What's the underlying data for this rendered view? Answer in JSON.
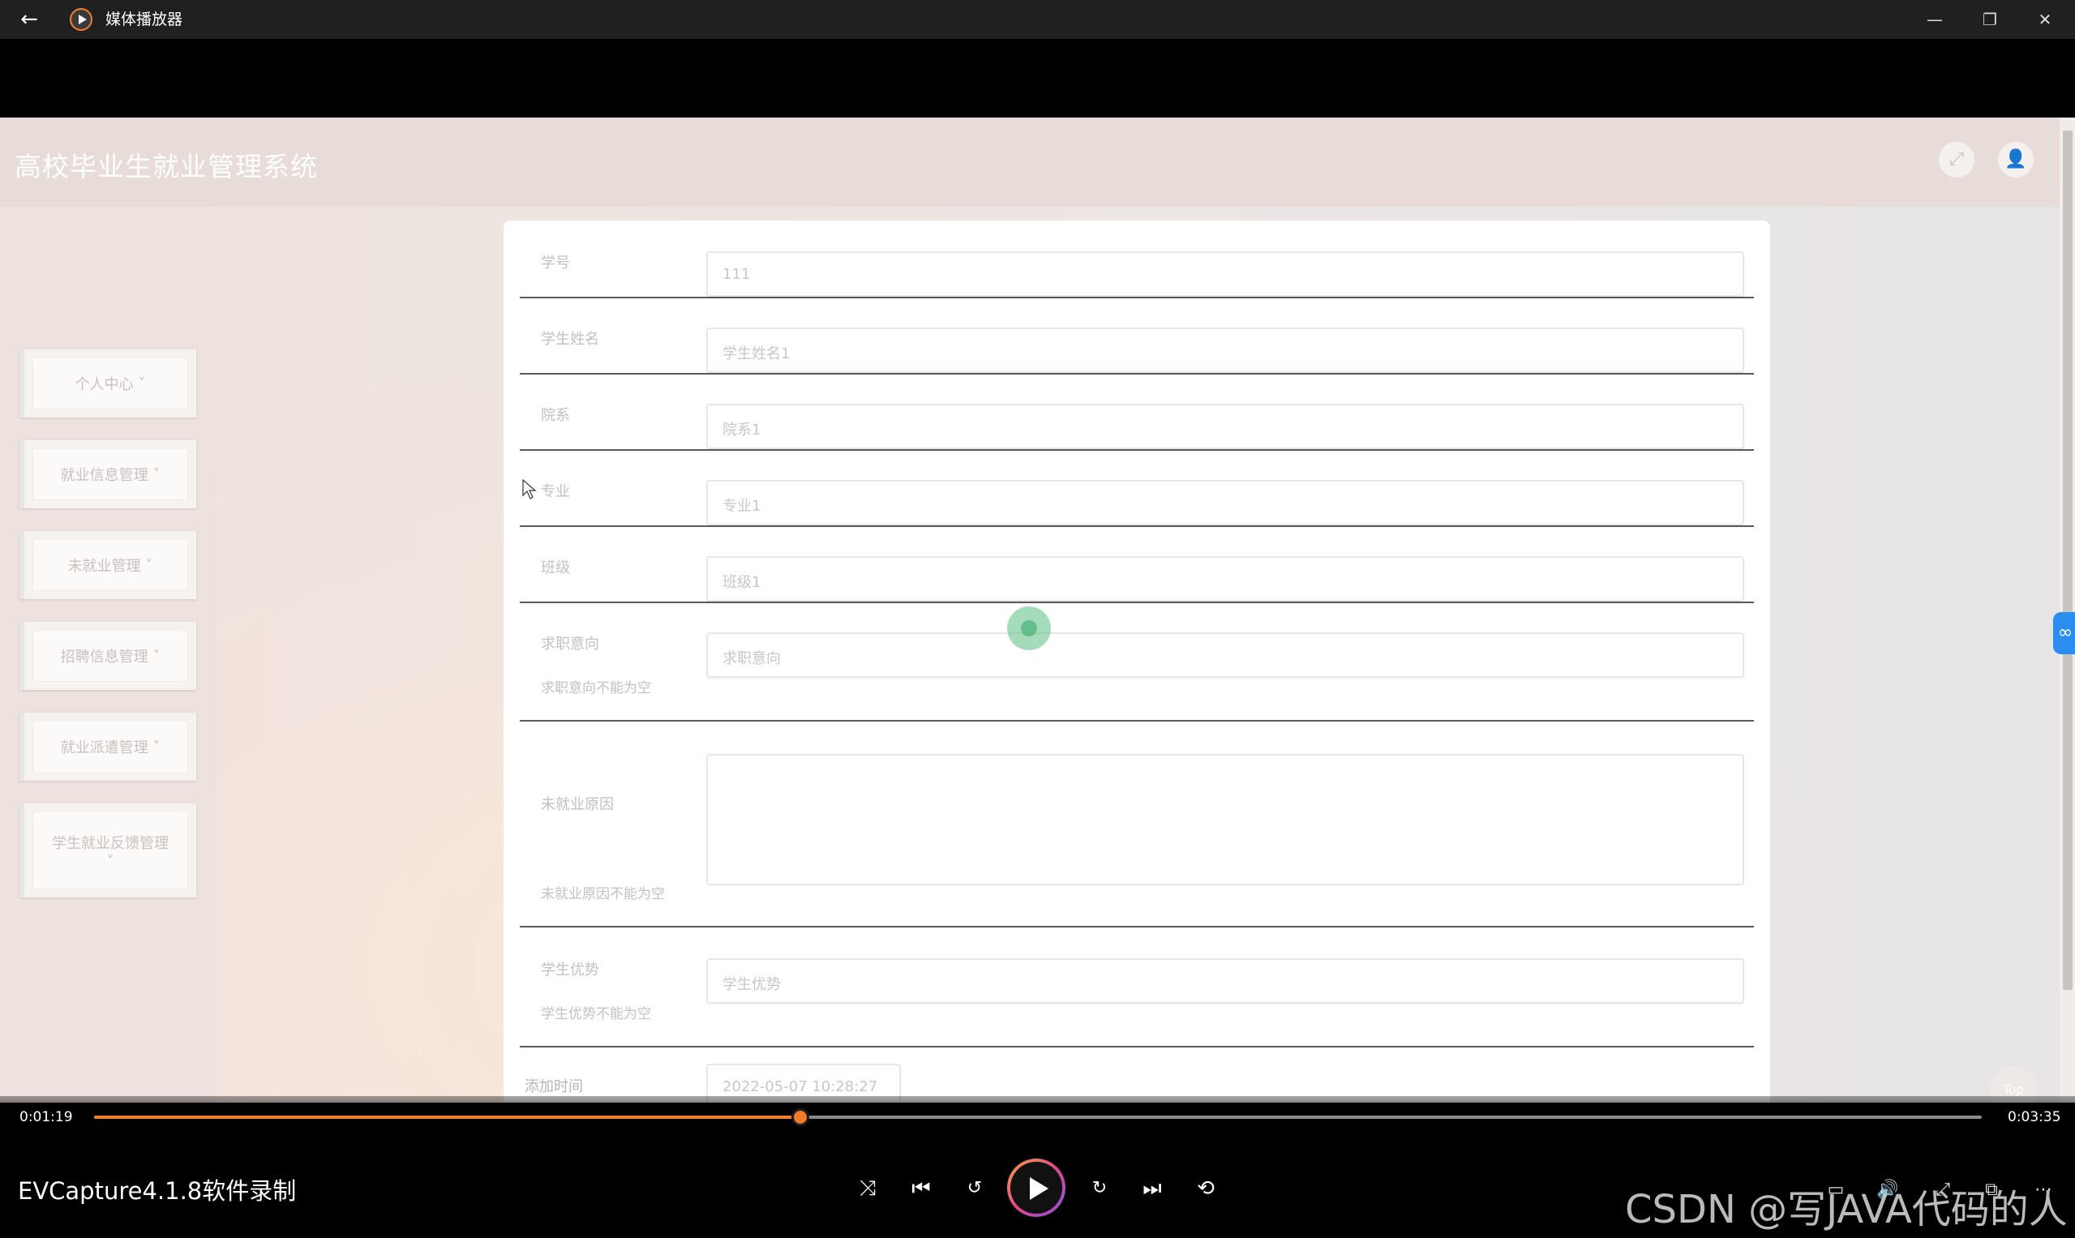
{
  "window": {
    "title": "媒体播放器",
    "back_icon": "back-arrow-icon",
    "app_icon": "media-player-icon",
    "minimize_icon": "minimize-icon",
    "restore_icon": "restore-icon",
    "close_icon": "close-icon"
  },
  "app": {
    "title": "高校毕业生就业管理系统",
    "fullscreen_icon": "fullscreen-icon",
    "user_icon": "user-icon"
  },
  "sidebar": {
    "items": [
      {
        "label": "个人中心"
      },
      {
        "label": "就业信息管理"
      },
      {
        "label": "未就业管理"
      },
      {
        "label": "招聘信息管理"
      },
      {
        "label": "就业派遣管理"
      },
      {
        "label": "学生就业反馈管理"
      }
    ]
  },
  "form": {
    "fields": [
      {
        "label": "学号",
        "value": "111"
      },
      {
        "label": "学生姓名",
        "value": "学生姓名1"
      },
      {
        "label": "院系",
        "value": "院系1"
      },
      {
        "label": "专业",
        "value": "专业1"
      },
      {
        "label": "班级",
        "value": "班级1"
      },
      {
        "label": "求职意向",
        "placeholder": "求职意向",
        "error": "求职意向不能为空"
      },
      {
        "label": "未就业原因",
        "value": "",
        "error": "未就业原因不能为空"
      },
      {
        "label": "学生优势",
        "placeholder": "学生优势",
        "error": "学生优势不能为空"
      },
      {
        "label": "添加时间",
        "value": "2022-05-07 10:28:27"
      }
    ]
  },
  "top_button": "Top",
  "player": {
    "current_time": "0:01:19",
    "total_time": "0:03:35",
    "progress": 0.374,
    "caption": "EVCapture4.1.8软件录制",
    "watermark": "CSDN @写JAVA代码的人",
    "accent": "#f07b2a",
    "icons": [
      "shuffle-icon",
      "previous-icon",
      "rewind-10-icon",
      "play-icon",
      "forward-30-icon",
      "next-icon",
      "repeat-off-icon"
    ]
  }
}
